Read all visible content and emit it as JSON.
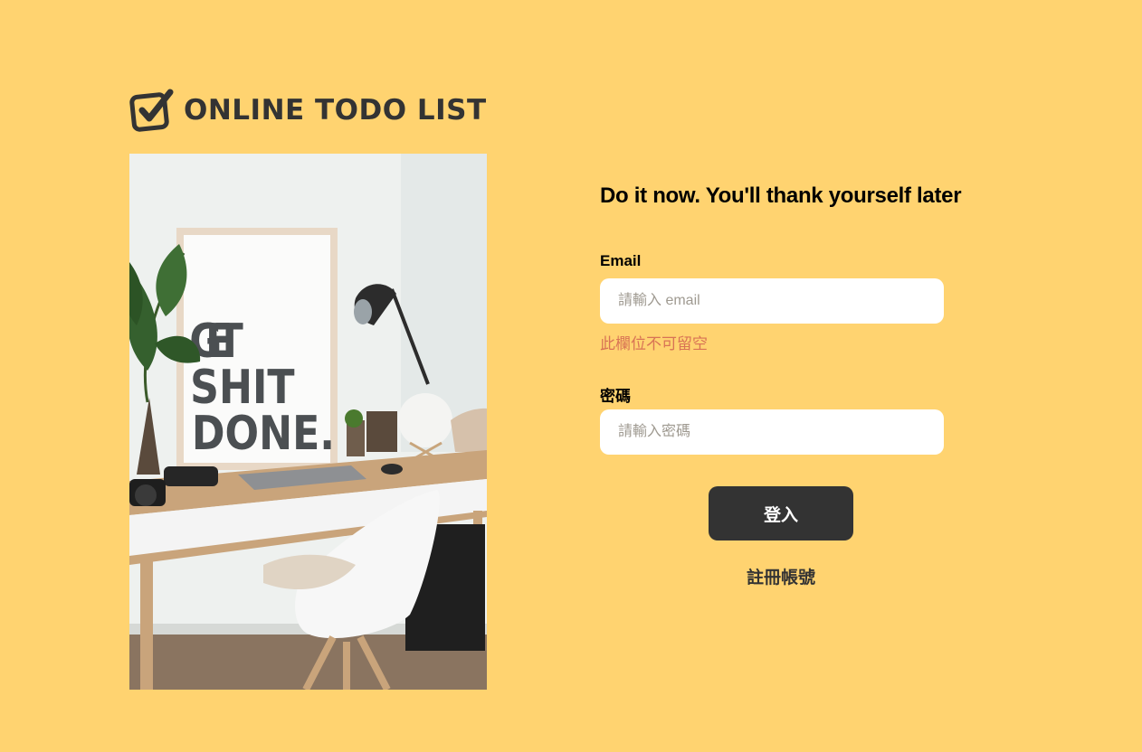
{
  "brand": {
    "name": "ONLINE TODO LIST",
    "icon": "checkbox-icon"
  },
  "illustration": {
    "poster_lines": [
      "GET",
      "SHIT",
      "DONE."
    ]
  },
  "form": {
    "headline": "Do it now. You'll thank yourself later",
    "email": {
      "label": "Email",
      "placeholder": "請輸入 email",
      "value": "",
      "error": "此欄位不可留空"
    },
    "password": {
      "label": "密碼",
      "placeholder": "請輸入密碼",
      "value": ""
    },
    "login_label": "登入",
    "signup_label": "註冊帳號"
  },
  "colors": {
    "background": "#FFD370",
    "primary": "#333333",
    "error": "#D87355"
  }
}
